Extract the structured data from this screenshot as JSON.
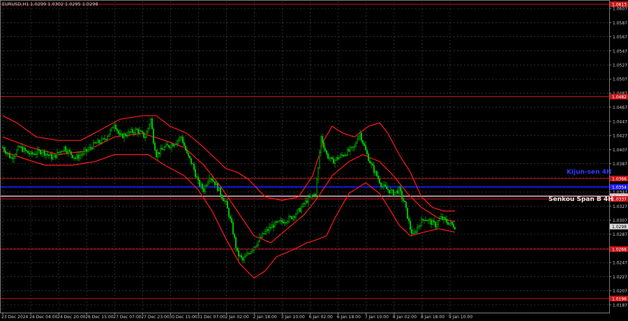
{
  "header": {
    "symbol_line": "EURUSD,H1  1.0299 1.0302 1.0295 1.0298"
  },
  "colors": {
    "background": "#000000",
    "grid": "#4a4a4a",
    "candle": "#00c000",
    "bollinger": "#ff1a1a",
    "level_red": "#c81414",
    "kijun": "#1c1cff",
    "senkou": "#e0b4c8",
    "text": "#c8c8c8",
    "price_tag": "#2a2a2a"
  },
  "overlays": {
    "kijun_label": "Kijun-sen 4H",
    "senkou_label": "Senkou Span B 4H"
  },
  "chart_data": {
    "type": "candlestick",
    "symbol": "EURUSD",
    "timeframe": "H1",
    "ylim": [
      1.0176,
      1.0617
    ],
    "y_ticks": [
      "1.0187",
      "1.0207",
      "1.0227",
      "1.0247",
      "1.0267",
      "1.0287",
      "1.0307",
      "1.0327",
      "1.0347",
      "1.0367",
      "1.0387",
      "1.0407",
      "1.0427",
      "1.0447",
      "1.0467",
      "1.0487",
      "1.0507",
      "1.0527",
      "1.0547",
      "1.0567",
      "1.0587",
      "1.0607"
    ],
    "x_ticks": [
      "23 Dec 2024",
      "24 Dec 04:00",
      "24 Dec 20:00",
      "26 Dec 15:00",
      "27 Dec 07:00",
      "27 Dec 23:00",
      "30 Dec 15:00",
      "31 Dec 07:00",
      "2 Jan 02:00",
      "2 Jan 18:00",
      "3 Jan 10:00",
      "6 Jan 02:00",
      "6 Jan 18:00",
      "7 Jan 10:00",
      "8 Jan 02:00",
      "8 Jan 18:00",
      "9 Jan 10:00"
    ],
    "last_price": "1.0298",
    "horizontal_levels": [
      {
        "name": "top",
        "value": 1.0613,
        "label": "1.0613",
        "color": "#c81414"
      },
      {
        "name": "r1",
        "value": 1.0482,
        "label": "1.0482",
        "color": "#c81414"
      },
      {
        "name": "r2",
        "value": 1.0366,
        "label": "1.0366",
        "color": "#c81414"
      },
      {
        "name": "kijun",
        "value": 1.0354,
        "label": "1.0354",
        "color": "#1c1cff"
      },
      {
        "name": "senkou",
        "value": 1.0341,
        "label": "1.0341",
        "color": "#e0b4c8"
      },
      {
        "name": "r3",
        "value": 1.0337,
        "label": "1.0337",
        "color": "#c81414"
      },
      {
        "name": "s1",
        "value": 1.0266,
        "label": "1.0266",
        "color": "#c81414"
      },
      {
        "name": "s2",
        "value": 1.0196,
        "label": "1.0196",
        "color": "#c81414"
      }
    ],
    "close_path": [
      [
        0,
        1.041
      ],
      [
        6,
        1.0395
      ],
      [
        12,
        1.041
      ],
      [
        20,
        1.04
      ],
      [
        28,
        1.0405
      ],
      [
        36,
        1.0395
      ],
      [
        44,
        1.041
      ],
      [
        52,
        1.0395
      ],
      [
        60,
        1.0405
      ],
      [
        66,
        1.0415
      ],
      [
        72,
        1.042
      ],
      [
        78,
        1.0435
      ],
      [
        80,
        1.0445
      ],
      [
        84,
        1.0425
      ],
      [
        90,
        1.043
      ],
      [
        96,
        1.0435
      ],
      [
        102,
        1.0425
      ],
      [
        106,
        1.045
      ],
      [
        108,
        1.042
      ],
      [
        110,
        1.04
      ],
      [
        116,
        1.041
      ],
      [
        122,
        1.0415
      ],
      [
        128,
        1.0425
      ],
      [
        132,
        1.04
      ],
      [
        136,
        1.0385
      ],
      [
        140,
        1.036
      ],
      [
        144,
        1.035
      ],
      [
        148,
        1.037
      ],
      [
        152,
        1.036
      ],
      [
        156,
        1.0345
      ],
      [
        160,
        1.033
      ],
      [
        164,
        1.03
      ],
      [
        168,
        1.026
      ],
      [
        172,
        1.025
      ],
      [
        176,
        1.026
      ],
      [
        182,
        1.0275
      ],
      [
        188,
        1.029
      ],
      [
        194,
        1.03
      ],
      [
        200,
        1.0305
      ],
      [
        206,
        1.031
      ],
      [
        212,
        1.032
      ],
      [
        218,
        1.0335
      ],
      [
        224,
        1.0345
      ],
      [
        226,
        1.038
      ],
      [
        228,
        1.0425
      ],
      [
        232,
        1.04
      ],
      [
        236,
        1.039
      ],
      [
        240,
        1.0395
      ],
      [
        244,
        1.04
      ],
      [
        248,
        1.0405
      ],
      [
        252,
        1.041
      ],
      [
        254,
        1.0425
      ],
      [
        256,
        1.043
      ],
      [
        260,
        1.0405
      ],
      [
        264,
        1.0385
      ],
      [
        268,
        1.037
      ],
      [
        272,
        1.0355
      ],
      [
        276,
        1.035
      ],
      [
        280,
        1.0345
      ],
      [
        284,
        1.035
      ],
      [
        288,
        1.033
      ],
      [
        292,
        1.0295
      ],
      [
        294,
        1.0285
      ],
      [
        298,
        1.03
      ],
      [
        302,
        1.031
      ],
      [
        306,
        1.0305
      ],
      [
        310,
        1.03
      ],
      [
        314,
        1.031
      ],
      [
        318,
        1.0305
      ],
      [
        324,
        1.0298
      ]
    ],
    "bollinger": {
      "upper": [
        [
          0,
          1.0455
        ],
        [
          10,
          1.0445
        ],
        [
          24,
          1.0425
        ],
        [
          40,
          1.042
        ],
        [
          56,
          1.042
        ],
        [
          70,
          1.0435
        ],
        [
          84,
          1.045
        ],
        [
          100,
          1.0455
        ],
        [
          110,
          1.0455
        ],
        [
          120,
          1.044
        ],
        [
          132,
          1.043
        ],
        [
          144,
          1.041
        ],
        [
          152,
          1.0395
        ],
        [
          160,
          1.038
        ],
        [
          168,
          1.0375
        ],
        [
          176,
          1.0365
        ],
        [
          188,
          1.034
        ],
        [
          200,
          1.0335
        ],
        [
          212,
          1.034
        ],
        [
          222,
          1.037
        ],
        [
          230,
          1.042
        ],
        [
          236,
          1.044
        ],
        [
          244,
          1.043
        ],
        [
          252,
          1.0425
        ],
        [
          262,
          1.044
        ],
        [
          270,
          1.0445
        ],
        [
          276,
          1.043
        ],
        [
          284,
          1.04
        ],
        [
          292,
          1.0375
        ],
        [
          300,
          1.034
        ],
        [
          308,
          1.0325
        ],
        [
          316,
          1.032
        ],
        [
          324,
          1.032
        ]
      ],
      "middle": [
        [
          0,
          1.0425
        ],
        [
          20,
          1.041
        ],
        [
          40,
          1.04
        ],
        [
          60,
          1.0405
        ],
        [
          80,
          1.0425
        ],
        [
          100,
          1.043
        ],
        [
          116,
          1.042
        ],
        [
          130,
          1.041
        ],
        [
          144,
          1.0385
        ],
        [
          156,
          1.0355
        ],
        [
          168,
          1.032
        ],
        [
          180,
          1.0285
        ],
        [
          192,
          1.0275
        ],
        [
          204,
          1.0295
        ],
        [
          216,
          1.0315
        ],
        [
          226,
          1.034
        ],
        [
          236,
          1.037
        ],
        [
          248,
          1.039
        ],
        [
          258,
          1.04
        ],
        [
          270,
          1.039
        ],
        [
          280,
          1.037
        ],
        [
          290,
          1.0345
        ],
        [
          300,
          1.0325
        ],
        [
          312,
          1.031
        ],
        [
          324,
          1.0305
        ]
      ],
      "lower": [
        [
          0,
          1.0405
        ],
        [
          14,
          1.0395
        ],
        [
          30,
          1.0385
        ],
        [
          50,
          1.0385
        ],
        [
          66,
          1.039
        ],
        [
          80,
          1.04
        ],
        [
          92,
          1.04
        ],
        [
          104,
          1.04
        ],
        [
          116,
          1.0385
        ],
        [
          130,
          1.037
        ],
        [
          140,
          1.035
        ],
        [
          150,
          1.032
        ],
        [
          160,
          1.028
        ],
        [
          170,
          1.0245
        ],
        [
          180,
          1.0225
        ],
        [
          188,
          1.0235
        ],
        [
          196,
          1.0255
        ],
        [
          208,
          1.0265
        ],
        [
          218,
          1.0275
        ],
        [
          226,
          1.028
        ],
        [
          232,
          1.0285
        ],
        [
          238,
          1.031
        ],
        [
          248,
          1.0345
        ],
        [
          260,
          1.036
        ],
        [
          270,
          1.0345
        ],
        [
          278,
          1.032
        ],
        [
          284,
          1.03
        ],
        [
          292,
          1.0285
        ],
        [
          302,
          1.029
        ],
        [
          312,
          1.0295
        ],
        [
          324,
          1.029
        ]
      ]
    }
  }
}
